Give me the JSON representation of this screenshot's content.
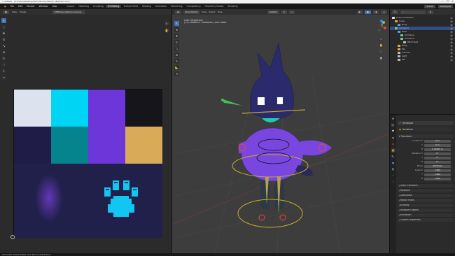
{
  "window": {
    "title": "* untitled - [C:\\Users\\Desktop\\Mochibunny.blend] - Blender 4.0.2",
    "controls": [
      "—",
      "☐",
      "✕"
    ]
  },
  "menubar": {
    "menus": [
      "File",
      "Edit",
      "Render",
      "Window",
      "Help"
    ],
    "workspaces": [
      "Layout",
      "Modeling",
      "Sculpting",
      "UV Editing",
      "Texture Paint",
      "Shading",
      "Animation",
      "Rendering",
      "Compositing",
      "Geometry Nodes",
      "Scripting"
    ],
    "active_workspace": "UV Editing",
    "scene": "Scene",
    "view_layer": "ViewLayer"
  },
  "uv_editor": {
    "mode": "View",
    "image_menu": "Image",
    "image_name": "Mitterbe_texturecolo.png",
    "tools": [
      "cursor",
      "select",
      "move",
      "rotate",
      "scale",
      "transform",
      "annotate",
      "grab",
      "pinch",
      "relax"
    ],
    "texture_swatches": [
      {
        "name": "light-grey",
        "color": "#dde3ee"
      },
      {
        "name": "cyan",
        "color": "#00d4f5"
      },
      {
        "name": "violet",
        "color": "#6c36d9"
      },
      {
        "name": "black",
        "color": "#16151c"
      },
      {
        "name": "dark-navy",
        "color": "#1f1c48"
      },
      {
        "name": "teal",
        "color": "#06848e"
      },
      {
        "name": "navy",
        "color": "#20204a"
      },
      {
        "name": "gold",
        "color": "#d9aa58"
      }
    ]
  },
  "viewport": {
    "mode": "Pose Mode",
    "menus": [
      "View",
      "Select",
      "Pose"
    ],
    "orientation": "Global",
    "info_line1": "User Perspective",
    "info_line2": "(12) Armature : Armature | DRX Head",
    "gizmo": {
      "x": "X",
      "y": "Y",
      "z": "Z"
    }
  },
  "outliner": {
    "search_placeholder": "",
    "display_mode": "View Layer",
    "rows": [
      {
        "label": "Scene Collection",
        "indent": 0,
        "selected": false,
        "color": "#ddd"
      },
      {
        "label": "Cube",
        "indent": 1,
        "selected": false,
        "color": "#e8a24a"
      },
      {
        "label": "Body",
        "indent": 2,
        "selected": false,
        "color": "#4aa3df"
      },
      {
        "label": "Armature",
        "indent": 1,
        "selected": true,
        "color": "#7ec488"
      },
      {
        "label": "Pose",
        "indent": 2,
        "selected": false,
        "color": "#4aa3df"
      },
      {
        "label": "Armature",
        "indent": 3,
        "selected": false,
        "color": "#7ec488"
      },
      {
        "label": "Armature",
        "indent": 3,
        "selected": false,
        "color": "#7ec488"
      },
      {
        "label": "DRX Head",
        "indent": 4,
        "selected": false,
        "color": "#bbb"
      },
      {
        "label": "Body",
        "indent": 2,
        "selected": false,
        "color": "#e8a24a"
      },
      {
        "label": "Fan",
        "indent": 2,
        "selected": false,
        "color": "#e8a24a"
      },
      {
        "label": "Camera",
        "indent": 2,
        "selected": false,
        "color": "#bbb"
      },
      {
        "label": "Light",
        "indent": 2,
        "selected": false,
        "color": "#bbb"
      },
      {
        "label": "Tail",
        "indent": 2,
        "selected": false,
        "color": "#bbb"
      }
    ]
  },
  "properties": {
    "object_name": "Armature",
    "data_name": "Armature",
    "transform_header": "Transform",
    "rows": [
      {
        "label": "Location X",
        "value": "0 m"
      },
      {
        "label": "Y",
        "value": "0 m"
      },
      {
        "label": "Z",
        "value": "0.00765 m"
      },
      {
        "label": "Rotation X",
        "value": "0°"
      },
      {
        "label": "Y",
        "value": "0°"
      },
      {
        "label": "Z",
        "value": "0°"
      },
      {
        "label": "Mode",
        "value": "XYZ Euler"
      },
      {
        "label": "Scale X",
        "value": "1.000"
      },
      {
        "label": "Y",
        "value": "1.000"
      },
      {
        "label": "Z",
        "value": "1.000"
      }
    ],
    "panels": [
      "Delta Transform",
      "Relations",
      "Collections",
      "Motion Paths",
      "Visibility",
      "Viewport Display",
      "Animation",
      "Custom Properties"
    ]
  },
  "statusbar": {
    "text": "Select   Box Select   Rotate View   Pose Context Menu"
  }
}
